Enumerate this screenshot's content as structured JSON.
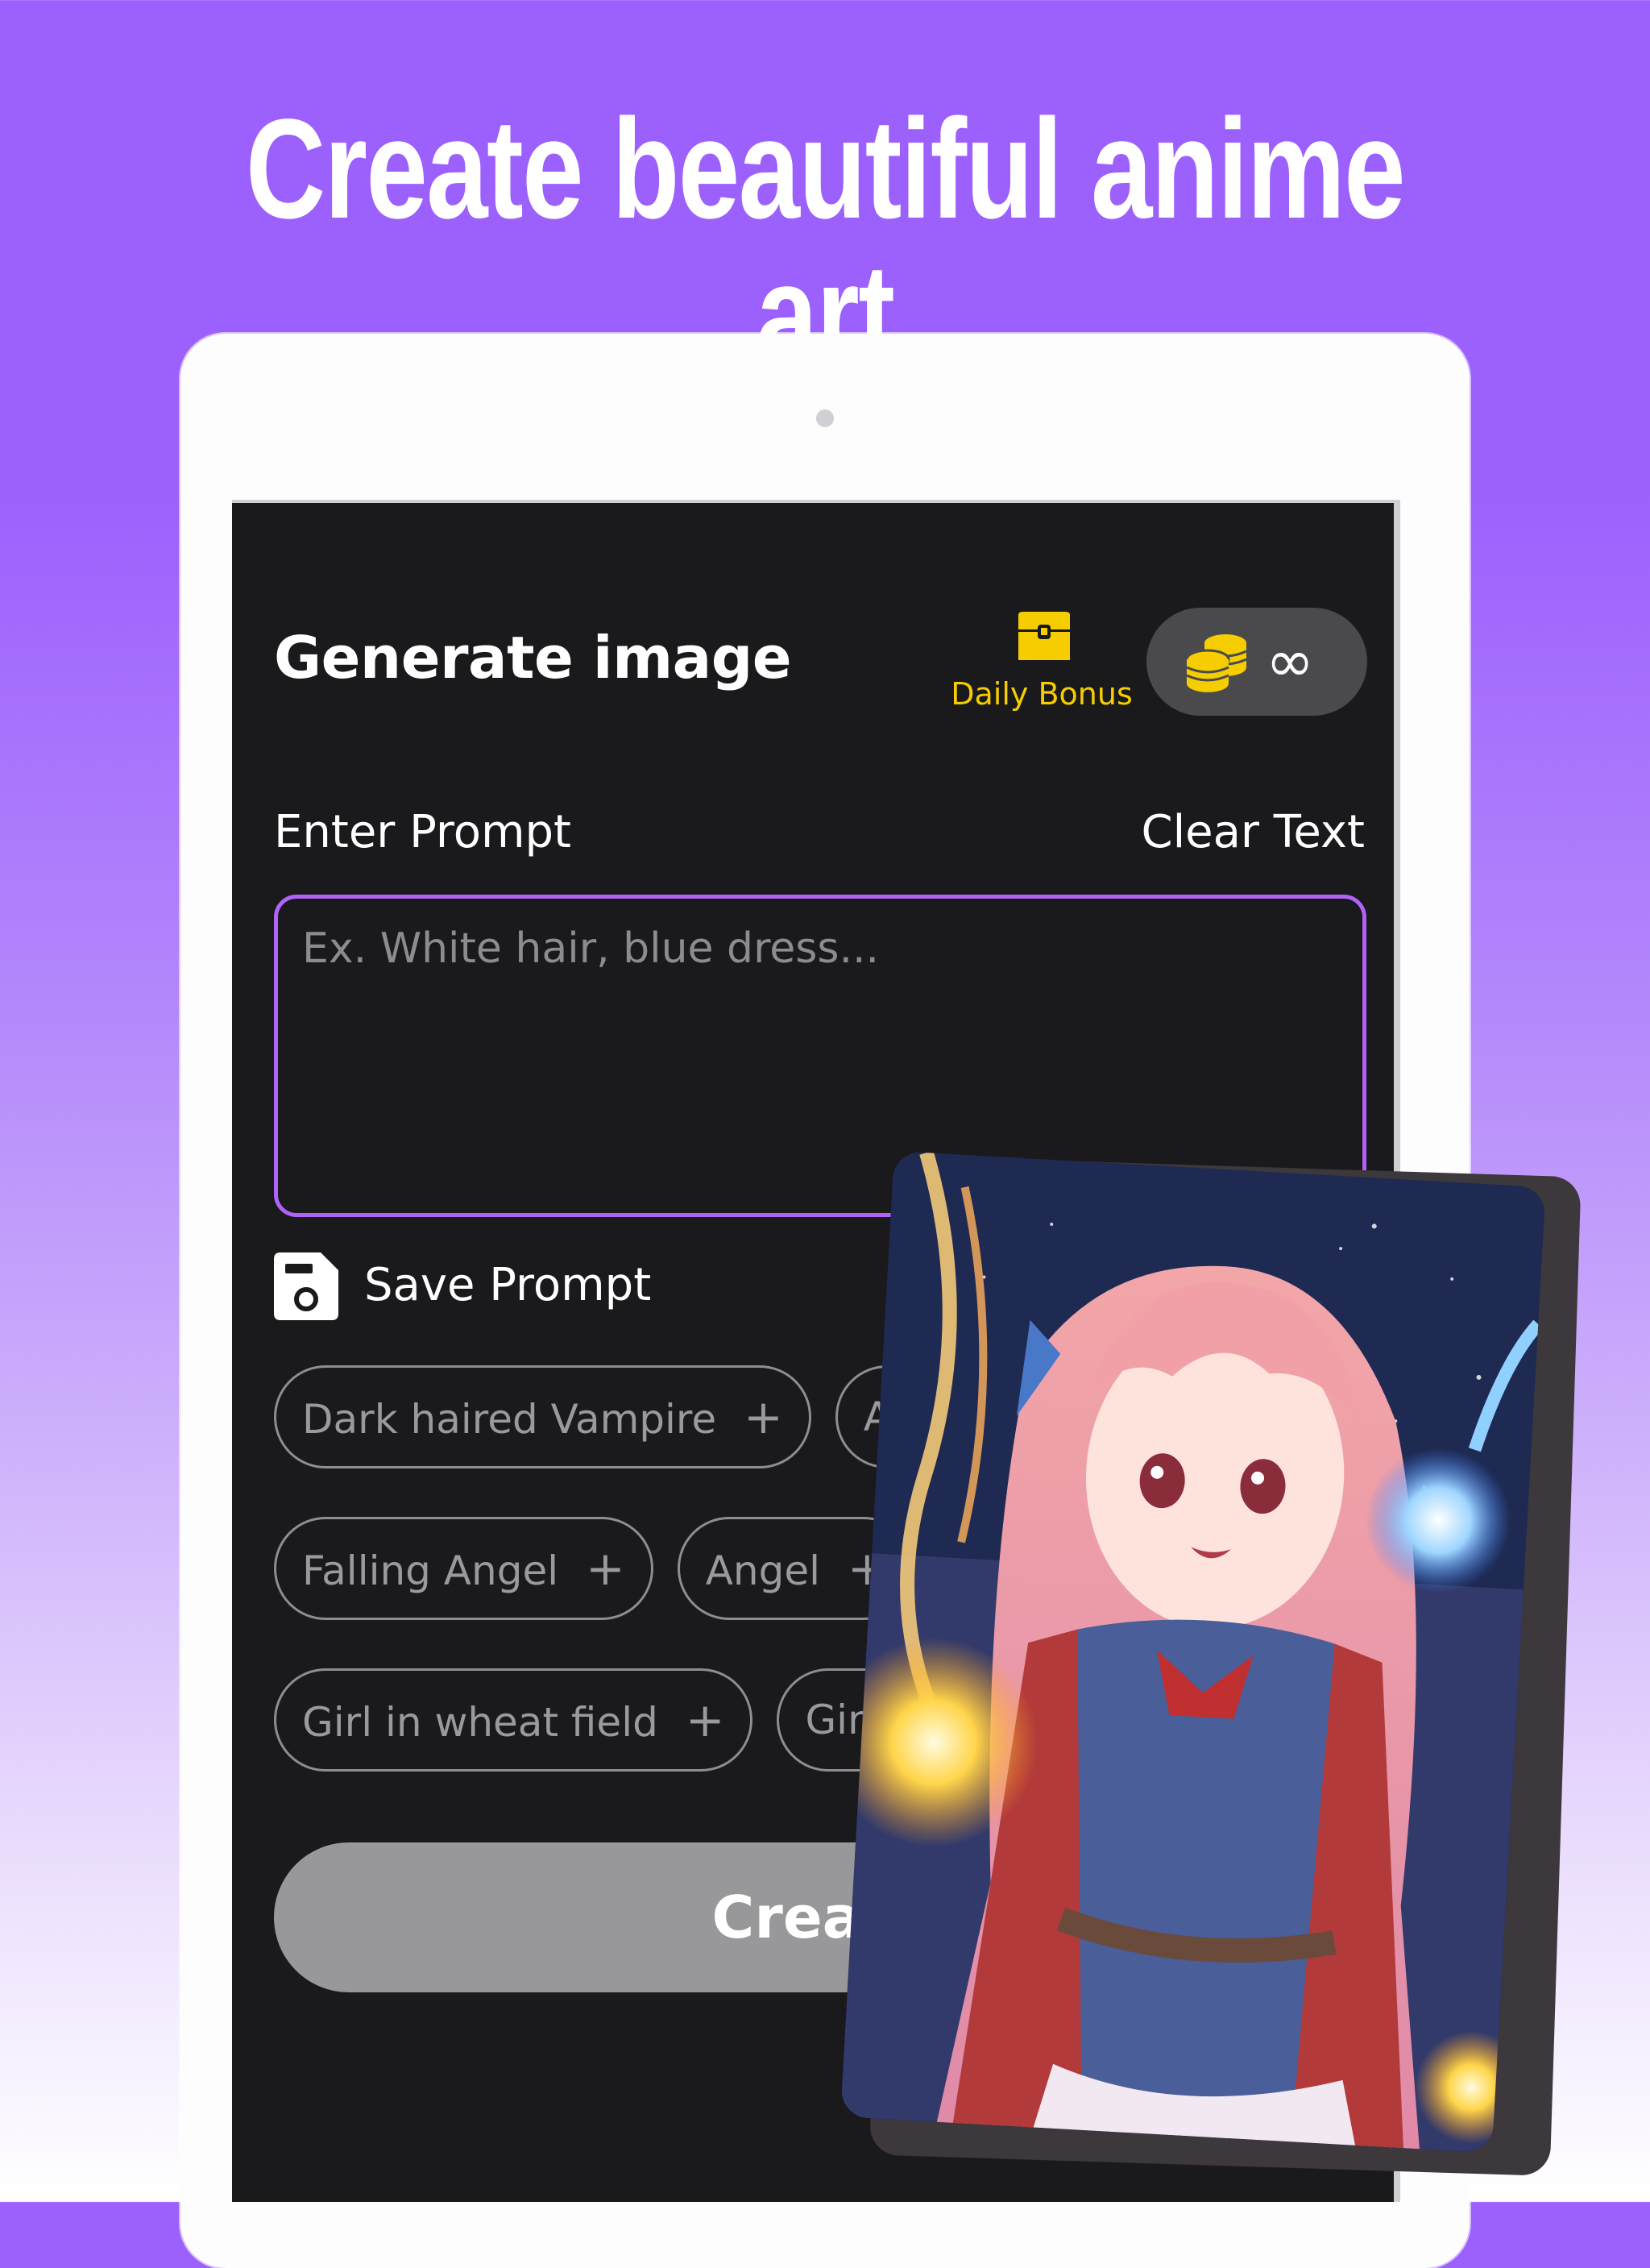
{
  "headline": "Create beautiful anime art",
  "app": {
    "title": "Generate image",
    "daily_bonus": {
      "label": "Daily Bonus",
      "icon": "treasure-chest-icon"
    },
    "coins": {
      "icon": "coins-icon",
      "value": "∞"
    },
    "prompt": {
      "label": "Enter Prompt",
      "clear_label": "Clear Text",
      "value": "",
      "placeholder": "Ex. White hair, blue dress..."
    },
    "save_prompt": {
      "label": "Save Prompt",
      "icon": "floppy-disk-icon"
    },
    "suggestions": [
      [
        "Dark haired Vampire",
        "Au"
      ],
      [
        "Falling Angel",
        "Angel"
      ],
      [
        "Girl in wheat field",
        "Girl a"
      ]
    ],
    "chip_plus": "+",
    "create_label": "Create"
  },
  "colors": {
    "background_purple": "#9c60fd",
    "accent_border": "#b063f6",
    "gold": "#f5cd00",
    "screen_bg": "#1a191c"
  },
  "preview_image": {
    "subject": "anime girl with pink hair casting light magic"
  }
}
